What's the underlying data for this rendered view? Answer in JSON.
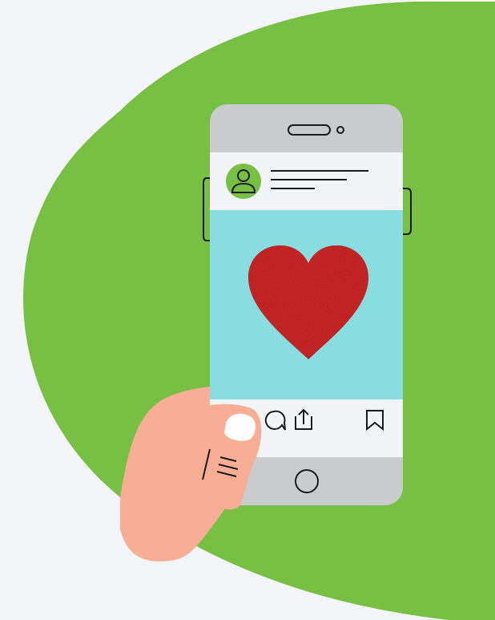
{
  "colors": {
    "background": "#f4f5f9",
    "blob": "#77c043",
    "phone_body": "#cacbcd",
    "screen_bg": "#f3f4f7",
    "post_image_bg": "#87dde0",
    "heart": "#d12a2a",
    "avatar": "#77c043",
    "skin": "#f7ae95",
    "nail": "#ffffff",
    "outline": "#1a1a1a"
  },
  "icons": {
    "speaker": "speaker-slot-icon",
    "camera": "front-camera-icon",
    "avatar": "user-avatar-icon",
    "heart": "heart-icon",
    "comment": "comment-bubble-icon",
    "share": "share-upload-icon",
    "bookmark": "bookmark-icon",
    "home": "home-button-icon"
  }
}
